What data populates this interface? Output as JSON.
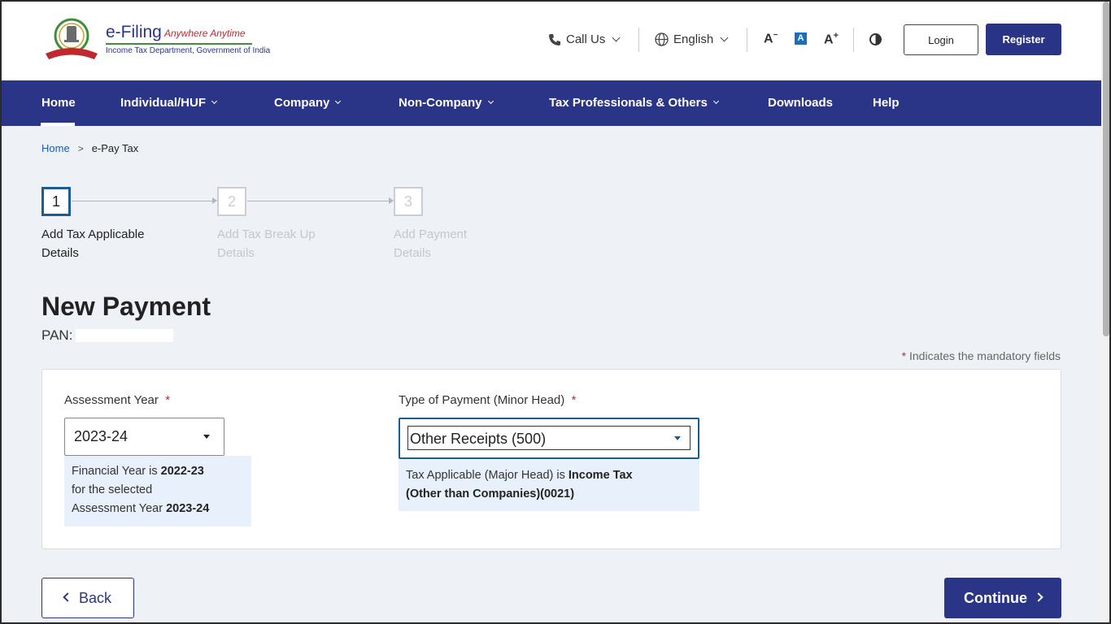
{
  "header": {
    "logo": {
      "title": "e-Filing",
      "tagline": "Anywhere Anytime",
      "subtitle": "Income Tax Department, Government of India",
      "emblem_icon": "government-emblem-icon"
    },
    "call_us": "Call Us",
    "language": "English",
    "font_decrease": "A",
    "font_default": "A",
    "font_increase": "A",
    "login_label": "Login",
    "register_label": "Register"
  },
  "nav": {
    "items": [
      {
        "label": "Home",
        "active": true
      },
      {
        "label": "Individual/HUF",
        "dropdown": true
      },
      {
        "label": "Company",
        "dropdown": true
      },
      {
        "label": "Non-Company",
        "dropdown": true
      },
      {
        "label": "Tax Professionals & Others",
        "dropdown": true
      },
      {
        "label": "Downloads"
      },
      {
        "label": "Help"
      }
    ]
  },
  "breadcrumb": {
    "home": "Home",
    "separator": ">",
    "current": "e-Pay Tax"
  },
  "stepper": {
    "steps": [
      {
        "number": "1",
        "label": "Add Tax Applicable Details",
        "active": true
      },
      {
        "number": "2",
        "label": "Add Tax Break Up Details",
        "active": false
      },
      {
        "number": "3",
        "label": "Add Payment Details",
        "active": false
      }
    ]
  },
  "page": {
    "title": "New Payment",
    "pan_label": "PAN:",
    "mandatory_star": "*",
    "mandatory_note": "Indicates the mandatory fields"
  },
  "form": {
    "assessment_year": {
      "label": "Assessment Year",
      "required": "*",
      "value": "2023-24",
      "info_prefix": "Financial Year is",
      "info_fy": "2022-23",
      "info_mid": "for the selected",
      "info_ay_prefix": "Assessment Year",
      "info_ay": "2023-24"
    },
    "type_of_payment": {
      "label": "Type of Payment (Minor Head)",
      "required": "*",
      "value": "Other Receipts (500)",
      "info_prefix": "Tax Applicable (Major Head) is",
      "info_major_1": "Income Tax",
      "info_major_2": "(Other than Companies)(0021)"
    }
  },
  "actions": {
    "back_label": "Back",
    "continue_label": "Continue"
  },
  "colors": {
    "primary": "#2b3587",
    "accent_blue": "#1b5da4",
    "required_red": "#c0282d",
    "background": "#eef2f7"
  }
}
